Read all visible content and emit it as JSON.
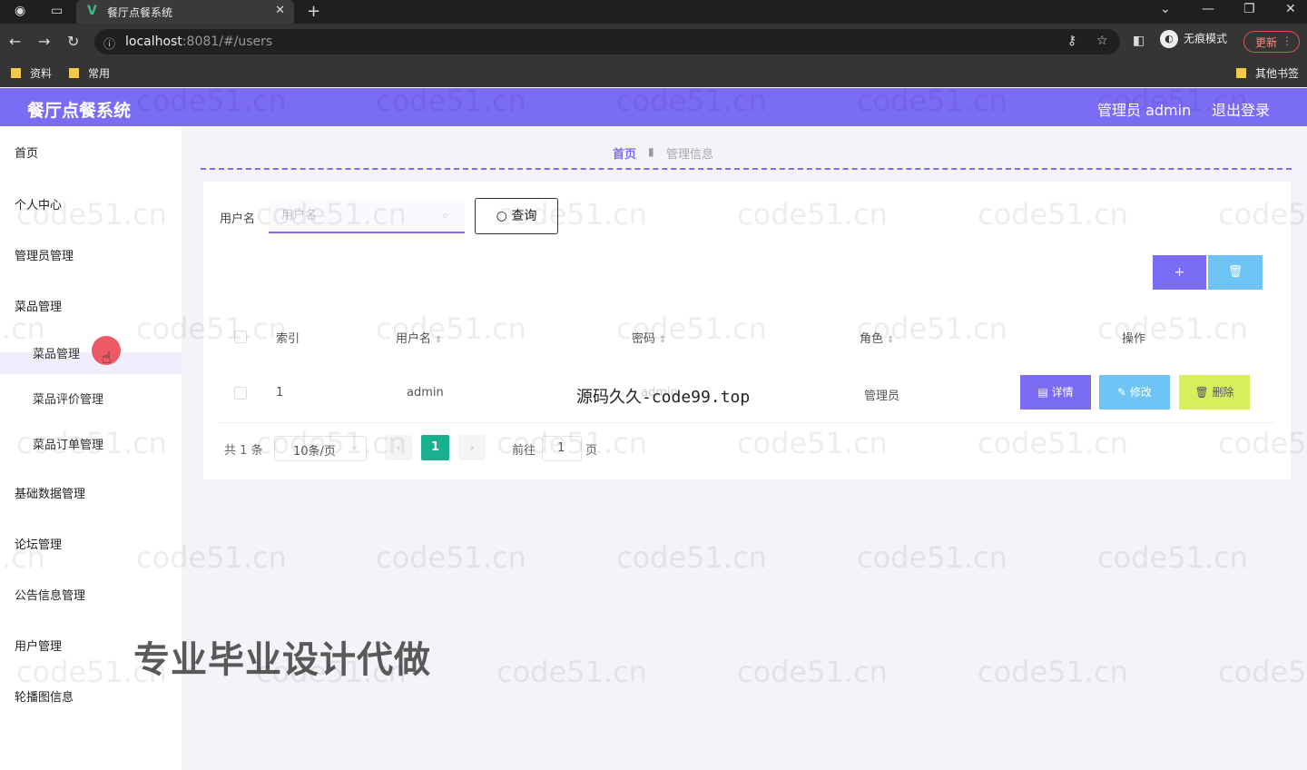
{
  "browser": {
    "tab_title": "餐厅点餐系统",
    "url_host": "localhost",
    "url_rest": ":8081/#/users",
    "incognito_label": "无痕模式",
    "update_label": "更新",
    "bookmarks": [
      "资料",
      "常用"
    ],
    "other_bookmarks": "其他书签"
  },
  "header": {
    "title": "餐厅点餐系统",
    "user_label": "管理员 admin",
    "logout_label": "退出登录"
  },
  "sidebar": {
    "items": [
      {
        "label": "首页"
      },
      {
        "label": "个人中心"
      },
      {
        "label": "管理员管理"
      },
      {
        "label": "菜品管理"
      },
      {
        "label": "菜品管理"
      },
      {
        "label": "菜品评价管理"
      },
      {
        "label": "菜品订单管理"
      },
      {
        "label": "基础数据管理"
      },
      {
        "label": "论坛管理"
      },
      {
        "label": "公告信息管理"
      },
      {
        "label": "用户管理"
      },
      {
        "label": "轮播图信息"
      }
    ]
  },
  "breadcrumb": {
    "home": "首页",
    "current": "管理信息"
  },
  "search": {
    "label": "用户名",
    "placeholder": "用户名",
    "button_label": "查询"
  },
  "toolbar": {
    "add_label": "+",
    "delete_label": "🗑"
  },
  "table": {
    "headers": [
      "索引",
      "用户名",
      "密码",
      "角色",
      "操作"
    ],
    "rows": [
      {
        "index": "1",
        "username": "admin",
        "password": "admin",
        "role": "管理员"
      }
    ],
    "actions": {
      "detail": "详情",
      "edit": "修改",
      "delete": "删除"
    }
  },
  "pagination": {
    "total": "共 1 条",
    "page_size": "10条/页",
    "current_page": "1",
    "goto_label": "前往",
    "goto_value": "1",
    "page_suffix": "页"
  },
  "overlays": {
    "source_text": "源码久久-code99.top",
    "promo_text": "专业毕业设计代做",
    "watermark": "code51.cn"
  },
  "colors": {
    "primary": "#7b6cf6",
    "info": "#6ec4f5",
    "warning": "#d6ef5c",
    "pager_active": "#18b08e"
  }
}
